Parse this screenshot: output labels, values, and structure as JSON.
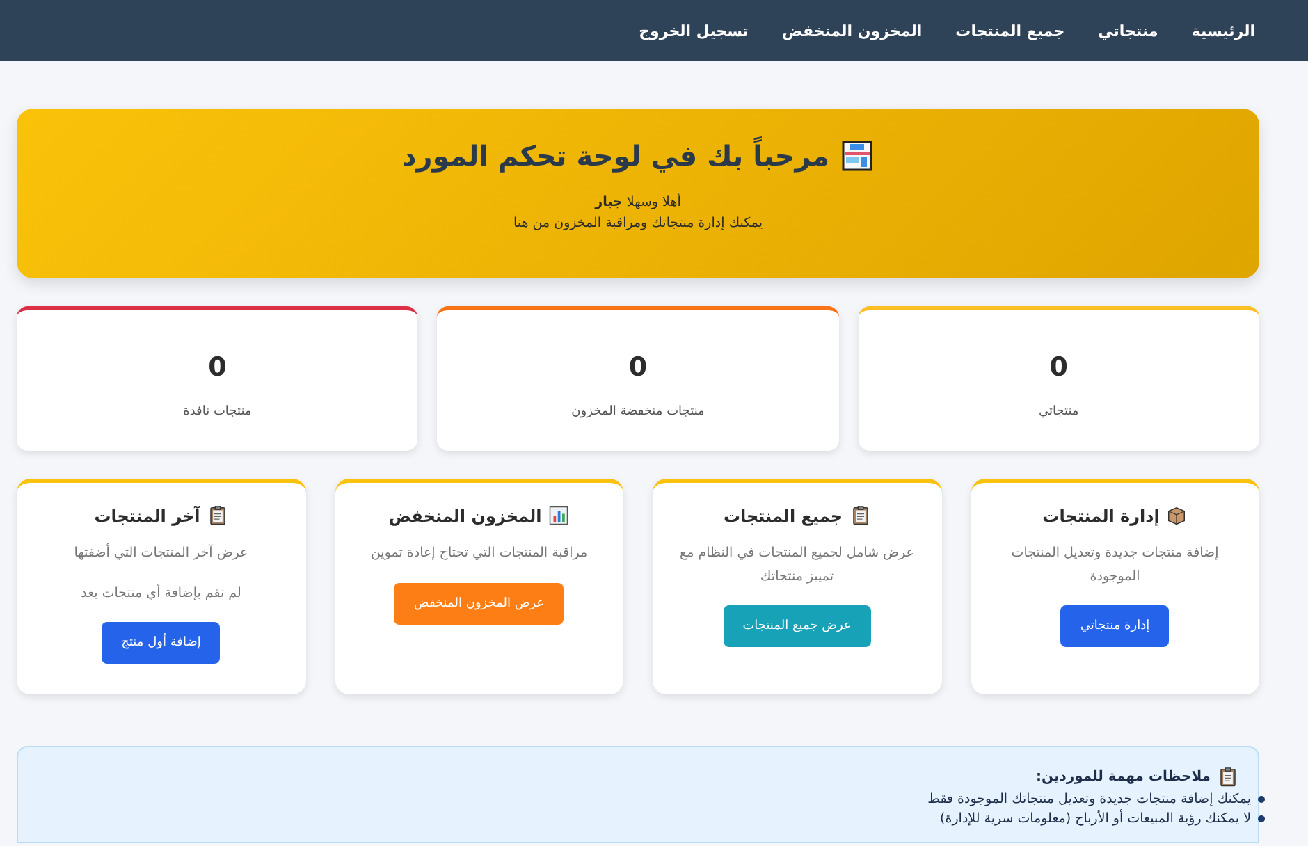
{
  "nav": {
    "items": [
      {
        "label": "الرئيسية"
      },
      {
        "label": "منتجاتي"
      },
      {
        "label": "جميع المنتجات"
      },
      {
        "label": "المخزون المنخفض"
      },
      {
        "label": "تسجيل الخروج"
      }
    ]
  },
  "hero": {
    "title": "مرحباً بك في لوحة تحكم المورد",
    "greeting": "أهلا وسهلا **جبار**",
    "subtitle": "يمكنك إدارة منتجاتك ومراقبة المخزون من هنا"
  },
  "stats": [
    {
      "value": "0",
      "label": "منتجاتي",
      "color": "#fbbf24"
    },
    {
      "value": "0",
      "label": "منتجات منخفضة المخزون",
      "color": "#f97316"
    },
    {
      "value": "0",
      "label": "منتجات نافدة",
      "color": "#dc2f45"
    }
  ],
  "actions": [
    {
      "kind": "box",
      "title": "إدارة المنتجات",
      "description": "إضافة منتجات جديدة وتعديل المنتجات الموجودة",
      "button": "إدارة منتجاتي",
      "color": "#2563eb"
    },
    {
      "kind": "clipboard",
      "title": "جميع المنتجات",
      "description": "عرض شامل لجميع المنتجات في النظام مع تمييز منتجاتك",
      "button": "عرض جميع المنتجات",
      "color": "#17a2b8"
    },
    {
      "kind": "chart",
      "title": "المخزون المنخفض",
      "description": "مراقبة المنتجات التي تحتاج إعادة تموين",
      "button": "عرض المخزون المنخفض",
      "color": "#fd7e14"
    },
    {
      "kind": "clipboard",
      "title": "آخر المنتجات",
      "description": "عرض آخر المنتجات التي أضفتها",
      "note": "لم تقم بإضافة أي منتجات بعد",
      "button": "إضافة أول منتج",
      "color": "#2563eb"
    }
  ],
  "notes": {
    "title": "ملاحظات مهمة للموردين:",
    "items": [
      "يمكنك إضافة منتجات جديدة وتعديل منتجاتك الموجودة فقط",
      "لا يمكنك رؤية المبيعات أو الأرباح (معلومات سرية للإدارة)"
    ]
  }
}
